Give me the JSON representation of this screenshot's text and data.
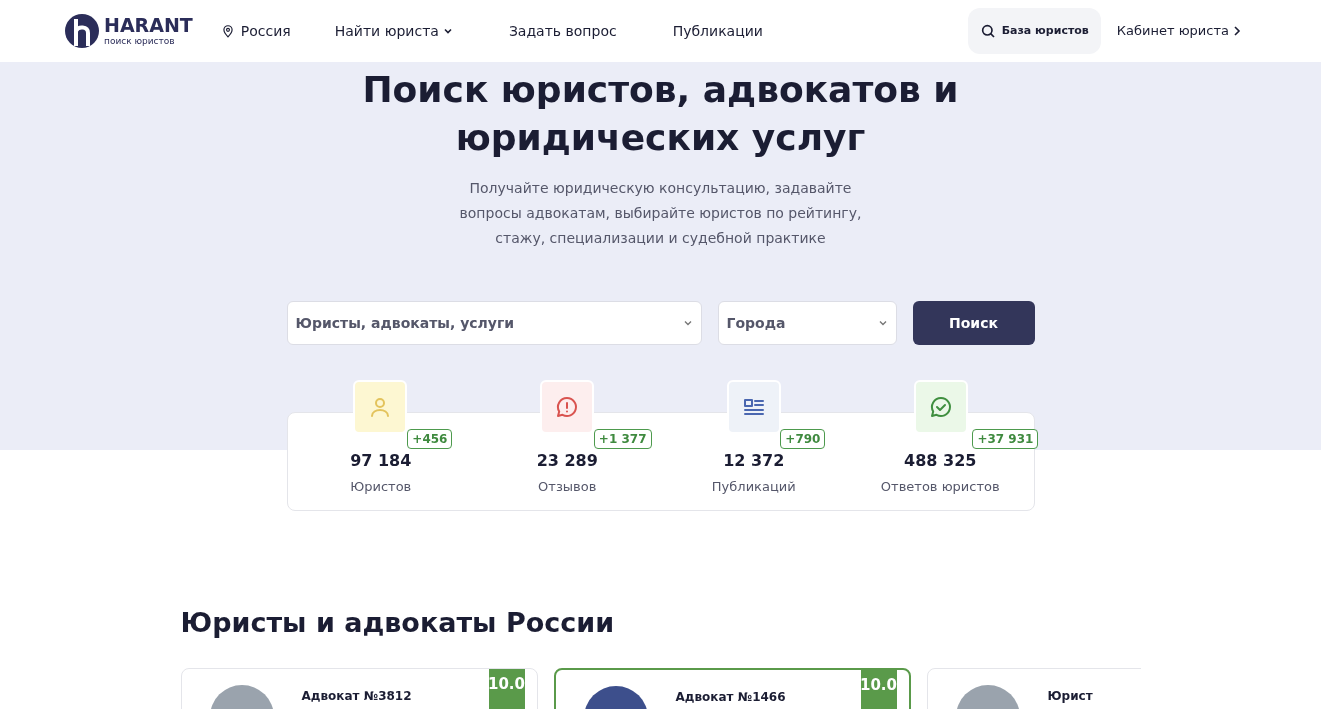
{
  "header": {
    "logo": {
      "name": "HARANT",
      "tagline": "поиск юристов"
    },
    "region": "Россия",
    "nav": [
      {
        "label": "Найти юриста",
        "dropdown": true
      },
      {
        "label": "Задать вопрос",
        "dropdown": false
      },
      {
        "label": "Публикации",
        "dropdown": false
      }
    ],
    "search_button": "База юристов",
    "cabinet_link": "Кабинет юриста"
  },
  "hero": {
    "title_lines": [
      "Поиск юристов, адвокатов и",
      "юридических услуг"
    ],
    "subtitle_lines": [
      "Получайте юридическую консультацию, задавайте",
      "вопросы адвокатам, выбирайте юристов по рейтингу,",
      "стажу, специализации и судебной практике"
    ],
    "search": {
      "query_placeholder": "Юристы, адвокаты, услуги",
      "city_placeholder": "Города",
      "button": "Поиск"
    }
  },
  "stats": [
    {
      "kind": "person",
      "color": "#e3c35c",
      "delta": "+456",
      "value": "97 184",
      "label": "Юристов"
    },
    {
      "kind": "alert",
      "color": "#d9534f",
      "delta": "+1 377",
      "value": "23 289",
      "label": "Отзывов"
    },
    {
      "kind": "article",
      "color": "#4a67b0",
      "delta": "+790",
      "value": "12 372",
      "label": "Публикаций"
    },
    {
      "kind": "check",
      "color": "#3f8f3f",
      "delta": "+37 931",
      "value": "488 325",
      "label": "Ответов юристов"
    }
  ],
  "lawyers_section": {
    "title": "Юристы и адвокаты России",
    "cards": [
      {
        "title": "Адвокат №3812",
        "score": "10.0",
        "featured": false
      },
      {
        "title": "Адвокат №1466",
        "score": "10.0",
        "featured": true
      },
      {
        "title": "Юрист",
        "featured": false
      }
    ]
  }
}
